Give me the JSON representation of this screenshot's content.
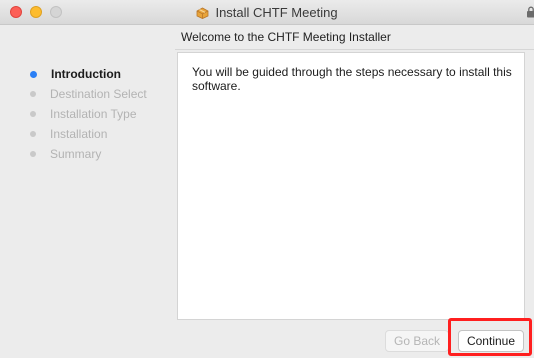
{
  "window": {
    "title": "Install CHTF Meeting",
    "title_icon": "package-icon",
    "lock_icon": "lock-icon"
  },
  "header": {
    "subtitle": "Welcome to the CHTF Meeting Installer"
  },
  "sidebar": {
    "steps": [
      {
        "label": "Introduction",
        "active": true
      },
      {
        "label": "Destination Select",
        "active": false
      },
      {
        "label": "Installation Type",
        "active": false
      },
      {
        "label": "Installation",
        "active": false
      },
      {
        "label": "Summary",
        "active": false
      }
    ]
  },
  "main": {
    "body_text": "You will be guided through the steps necessary to install this software."
  },
  "footer": {
    "back_label": "Go Back",
    "continue_label": "Continue",
    "highlight_color": "#ff1f1f"
  },
  "colors": {
    "accent": "#2a7ff5",
    "close": "#fc5f57",
    "minimize": "#fdbc2e",
    "zoom": "#d5d5d5"
  }
}
